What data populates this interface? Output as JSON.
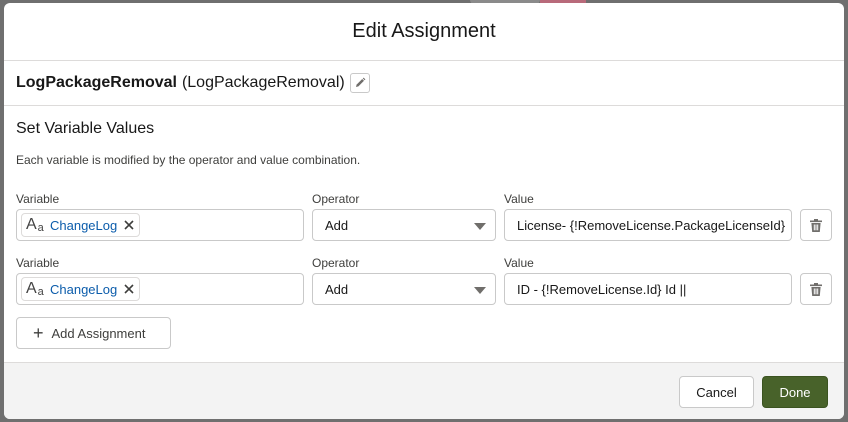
{
  "modal": {
    "title": "Edit Assignment"
  },
  "element": {
    "label": "LogPackageRemoval",
    "api_name": "(LogPackageRemoval)"
  },
  "section": {
    "title": "Set Variable Values",
    "description": "Each variable is modified by the operator and value combination."
  },
  "assignments": [
    {
      "variable_label": "Variable",
      "variable": "ChangeLog",
      "operator_label": "Operator",
      "operator": "Add",
      "value_label": "Value",
      "value": "License- {!RemoveLicense.PackageLicenseId}"
    },
    {
      "variable_label": "Variable",
      "variable": "ChangeLog",
      "operator_label": "Operator",
      "operator": "Add",
      "value_label": "Value",
      "value": "ID - {!RemoveLicense.Id} Id ||"
    }
  ],
  "add_assignment_label": "Add Assignment",
  "footer": {
    "cancel_label": "Cancel",
    "done_label": "Done"
  },
  "icons": {
    "edit": "pencil-icon",
    "text_type": "text-type-icon",
    "remove_pill": "close-icon",
    "delete_row": "trash-icon",
    "add": "plus-icon",
    "dropdown": "caret-down-icon"
  },
  "colors": {
    "pill_text": "#0b5cab",
    "done_button": "#48622a",
    "footer_bg": "#f3f3f3"
  }
}
